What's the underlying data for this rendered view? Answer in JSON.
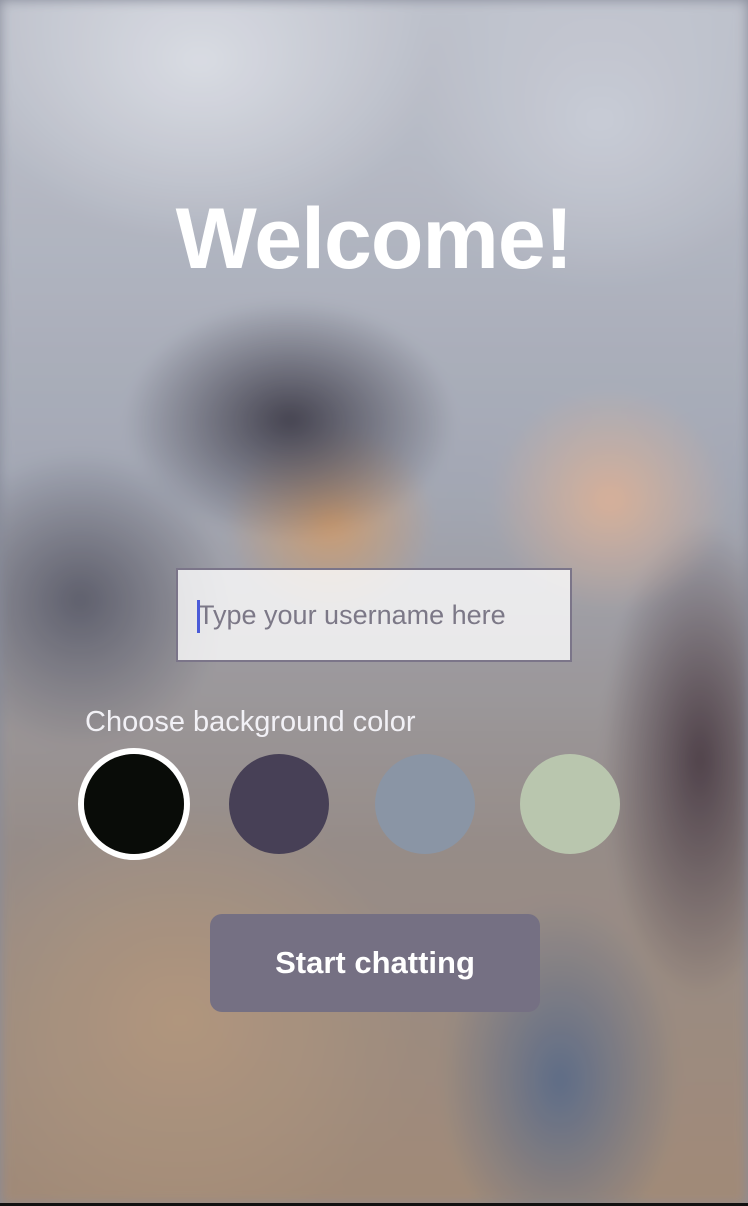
{
  "welcome": {
    "title": "Welcome!"
  },
  "username": {
    "value": "",
    "placeholder": "Type your username here"
  },
  "color_picker": {
    "label": "Choose background color",
    "selected_index": 0,
    "colors": [
      "#090C08",
      "#474056",
      "#8A95A5",
      "#B9C6AE"
    ]
  },
  "start_button": {
    "label": "Start chatting",
    "background": "#757083"
  }
}
